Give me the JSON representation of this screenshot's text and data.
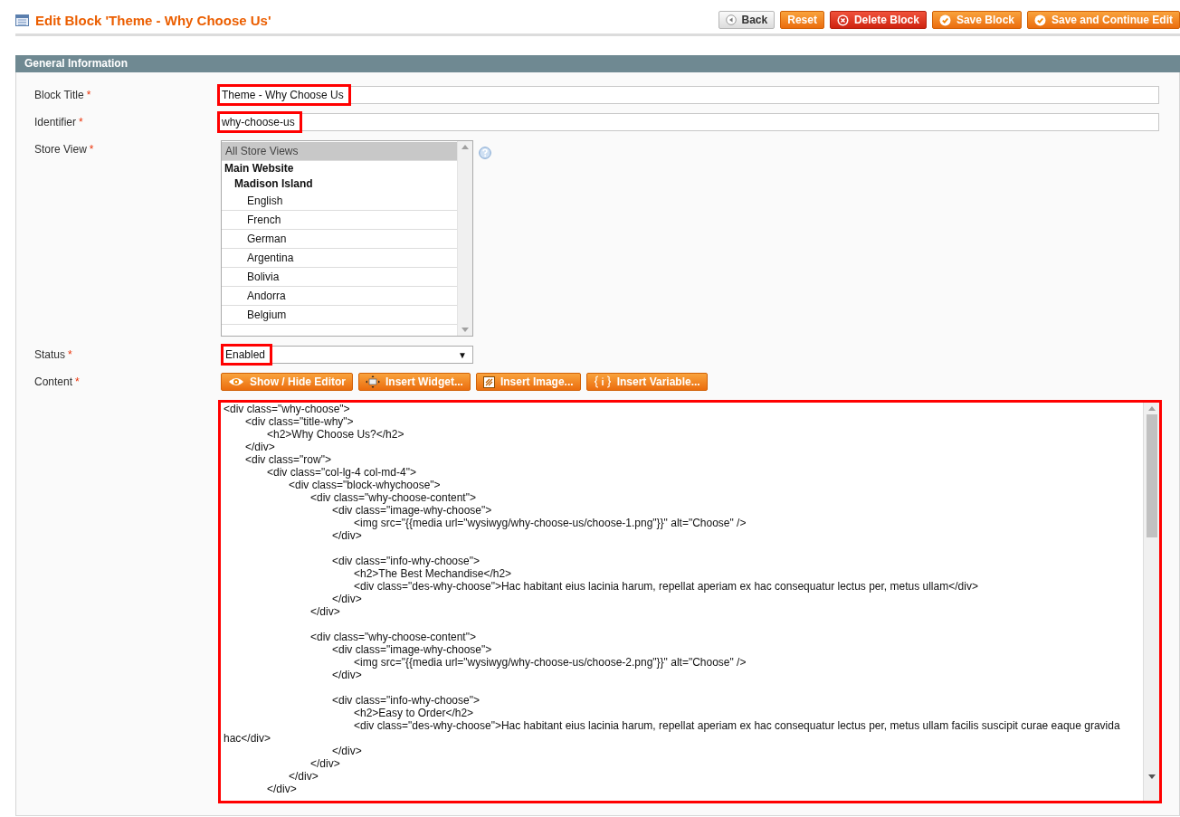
{
  "page": {
    "title": "Edit Block 'Theme - Why Choose Us'"
  },
  "header_buttons": [
    {
      "label": "Back",
      "kind": "back"
    },
    {
      "label": "Reset",
      "kind": "plain"
    },
    {
      "label": "Delete Block",
      "kind": "delete"
    },
    {
      "label": "Save Block",
      "kind": "save"
    },
    {
      "label": "Save and Continue Edit",
      "kind": "save"
    }
  ],
  "section": {
    "title": "General Information"
  },
  "fields": [
    {
      "kind": "text",
      "label": "Block Title",
      "required_mark": "*",
      "value": "Theme - Why Choose Us",
      "highlighted": true
    },
    {
      "kind": "text",
      "label": "Identifier",
      "required_mark": "*",
      "value": "why-choose-us",
      "highlighted": true
    },
    {
      "kind": "multiselect",
      "label": "Store View",
      "required_mark": "*",
      "options": [
        {
          "label": "All Store Views",
          "kind": "option",
          "selected": true
        },
        {
          "label": "Main Website",
          "kind": "group"
        },
        {
          "label": "Madison Island",
          "kind": "subgroup"
        },
        {
          "label": "English",
          "kind": "option",
          "selected": false
        },
        {
          "label": "French",
          "kind": "option",
          "selected": false
        },
        {
          "label": "German",
          "kind": "option",
          "selected": false
        },
        {
          "label": "Argentina",
          "kind": "option",
          "selected": false
        },
        {
          "label": "Bolivia",
          "kind": "option",
          "selected": false
        },
        {
          "label": "Andorra",
          "kind": "option",
          "selected": false
        },
        {
          "label": "Belgium",
          "kind": "option",
          "selected": false
        }
      ]
    },
    {
      "kind": "select",
      "label": "Status",
      "required_mark": "*",
      "value": "Enabled",
      "arrow": "▼",
      "highlighted": true
    },
    {
      "kind": "editor",
      "label": "Content",
      "required_mark": "*",
      "highlighted": true,
      "buttons": [
        {
          "label": "Show / Hide Editor",
          "kind": "eye"
        },
        {
          "label": "Insert Widget...",
          "kind": "widget"
        },
        {
          "label": "Insert Image...",
          "kind": "image"
        },
        {
          "label": "Insert Variable...",
          "kind": "variable"
        }
      ],
      "value": "<div class=\"why-choose\">\n\t<div class=\"title-why\">\n\t\t<h2>Why Choose Us?</h2>\n\t</div>\n\t<div class=\"row\">\n\t\t<div class=\"col-lg-4 col-md-4\">\n\t\t\t<div class=\"block-whychoose\">\n\t\t\t\t<div class=\"why-choose-content\">\n\t\t\t\t\t<div class=\"image-why-choose\">\n\t\t\t\t\t\t<img src=\"{{media url=\"wysiwyg/why-choose-us/choose-1.png\"}}\" alt=\"Choose\" />\n\t\t\t\t\t</div>\n\n\t\t\t\t\t<div class=\"info-why-choose\">\n\t\t\t\t\t\t<h2>The Best Mechandise</h2>\n\t\t\t\t\t\t<div class=\"des-why-choose\">Hac habitant eius lacinia harum, repellat aperiam ex hac consequatur lectus per, metus ullam</div>\n\t\t\t\t\t</div>\n\t\t\t\t</div>\n\n\t\t\t\t<div class=\"why-choose-content\">\n\t\t\t\t\t<div class=\"image-why-choose\">\n\t\t\t\t\t\t<img src=\"{{media url=\"wysiwyg/why-choose-us/choose-2.png\"}}\" alt=\"Choose\" />\n\t\t\t\t\t</div>\n\n\t\t\t\t\t<div class=\"info-why-choose\">\n\t\t\t\t\t\t<h2>Easy to Order</h2>\n\t\t\t\t\t\t<div class=\"des-why-choose\">Hac habitant eius lacinia harum, repellat aperiam ex hac consequatur lectus per, metus ullam facilis suscipit curae eaque gravida hac</div>\n\t\t\t\t\t</div>\n\t\t\t\t</div>\n\t\t\t</div>\n\t\t</div>"
    }
  ]
}
